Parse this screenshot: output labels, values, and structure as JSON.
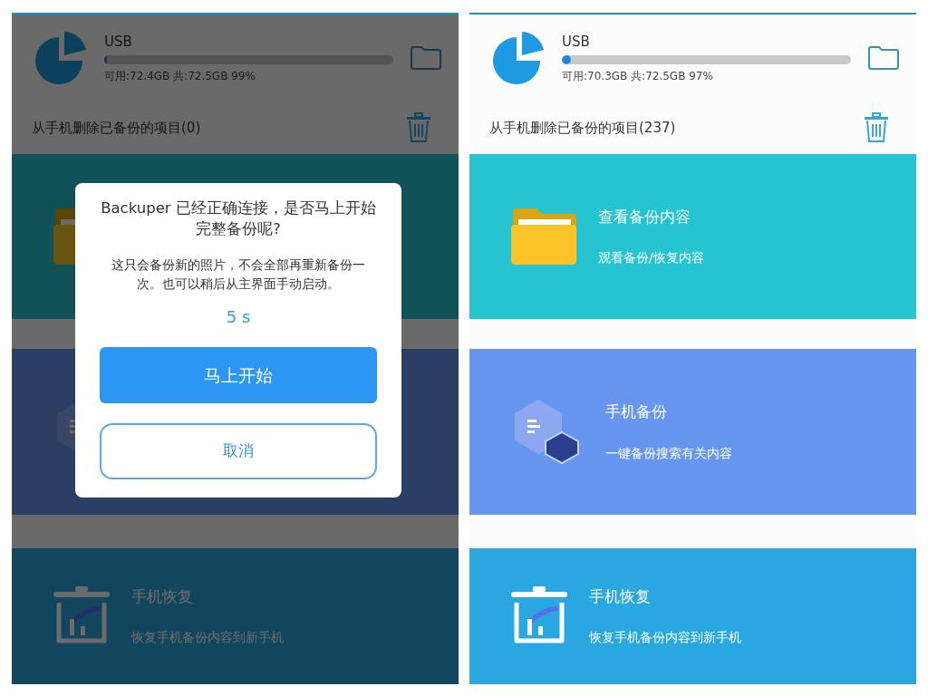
{
  "screens": [
    {
      "dimmed": true,
      "storage": {
        "label": "USB",
        "level": 0.01,
        "info": "可用:72.4GB 共:72.5GB  99%"
      },
      "delete_row": {
        "text": "从手机删除已备份的项目(0)"
      },
      "cards": [
        {
          "kind": "folder"
        },
        {
          "kind": "backup"
        },
        {
          "kind": "restore",
          "title": "手机恢复",
          "subtitle": "恢复手机备份内容到新手机"
        }
      ],
      "dialog": {
        "title": "Backuper 已经正确连接，是否马上开始完整备份呢?",
        "message": "这只会备份新的照片，不会全部再重新备份一次。也可以稍后从主界面手动启动。",
        "countdown": "5 s",
        "primary_button": "马上开始",
        "cancel_button": "取消"
      }
    },
    {
      "dimmed": false,
      "storage": {
        "label": "USB",
        "level": 0.03,
        "info": "可用:70.3GB 共:72.5GB  97%"
      },
      "delete_row": {
        "text": "从手机删除已备份的项目(237)"
      },
      "cards": [
        {
          "kind": "folder",
          "title": "查看备份内容",
          "subtitle": "观看备份/恢复内容"
        },
        {
          "kind": "backup",
          "title": "手机备份",
          "subtitle": "一键备份搜索有关内容"
        },
        {
          "kind": "restore",
          "title": "手机恢复",
          "subtitle": "恢复手机备份内容到新手机"
        }
      ]
    }
  ]
}
